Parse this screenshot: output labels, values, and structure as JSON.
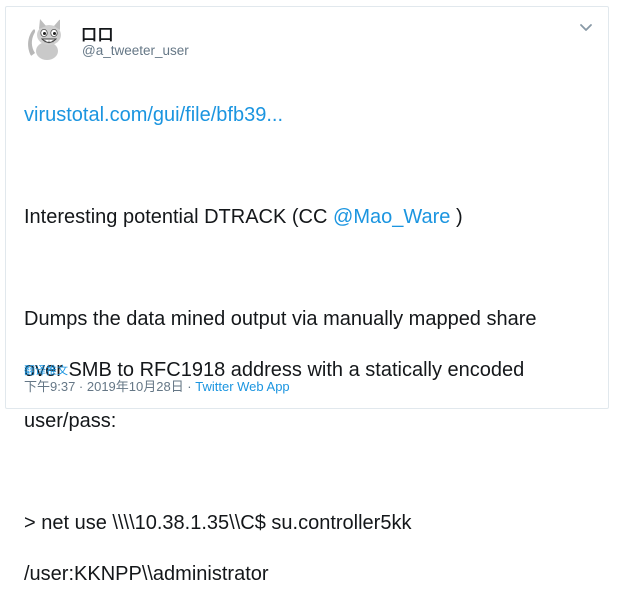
{
  "user": {
    "display_name": "口口",
    "handle": "@a_tweeter_user",
    "avatar_icon": "cat-avatar-icon"
  },
  "menu": {
    "caret_icon": "chevron-down-icon"
  },
  "tweet": {
    "link": "virustotal.com/gui/file/bfb39...",
    "line2_prefix": "Interesting potential DTRACK (CC ",
    "mention": "@Mao_Ware",
    "line2_suffix": " )",
    "para2_line1": "Dumps the data mined output via manually mapped share",
    "para2_line2": "over SMB to RFC1918 address with a statically encoded",
    "para2_line3": "user/pass:",
    "cmd_line1": "> net use \\\\\\\\10.38.1.35\\\\C$ su.controller5kk",
    "cmd_line2": "/user:KKNPP\\\\administrator"
  },
  "footer": {
    "translate": "翻译推文",
    "time": "下午9:37 · 2019年10月28日 · ",
    "source": "Twitter Web App"
  },
  "colors": {
    "link": "#1b95e0",
    "text": "#14171a",
    "muted": "#657786",
    "border": "#e1e8ed"
  }
}
